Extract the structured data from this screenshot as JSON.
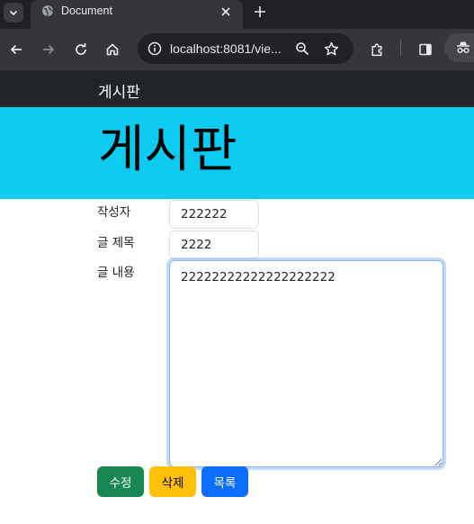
{
  "browser": {
    "tab": {
      "title": "Document"
    },
    "new_tab_symbol": "+",
    "url": "localhost:8081/vie...",
    "icons": [
      "chevron-down-icon",
      "globe-icon",
      "close-icon",
      "plus-icon",
      "back-arrow-icon",
      "forward-arrow-icon",
      "reload-icon",
      "home-icon",
      "site-info-icon",
      "zoom-icon",
      "star-icon",
      "extensions-icon",
      "side-panel-icon",
      "incognito-icon"
    ]
  },
  "navbar": {
    "brand": "게시판"
  },
  "jumbotron": {
    "title": "게시판"
  },
  "form": {
    "writer": {
      "label": "작성자",
      "value": "222222"
    },
    "title": {
      "label": "글 제목",
      "value": "2222"
    },
    "content": {
      "label": "글 내용",
      "value": "22222222222222222222"
    }
  },
  "buttons": {
    "edit": "수정",
    "delete": "삭제",
    "list": "목록"
  },
  "colors": {
    "navbar_bg": "#212529",
    "jumbotron_bg": "#0dcaf0",
    "edit_button": "#198754",
    "delete_button": "#ffc107",
    "list_button": "#0d6efd"
  }
}
